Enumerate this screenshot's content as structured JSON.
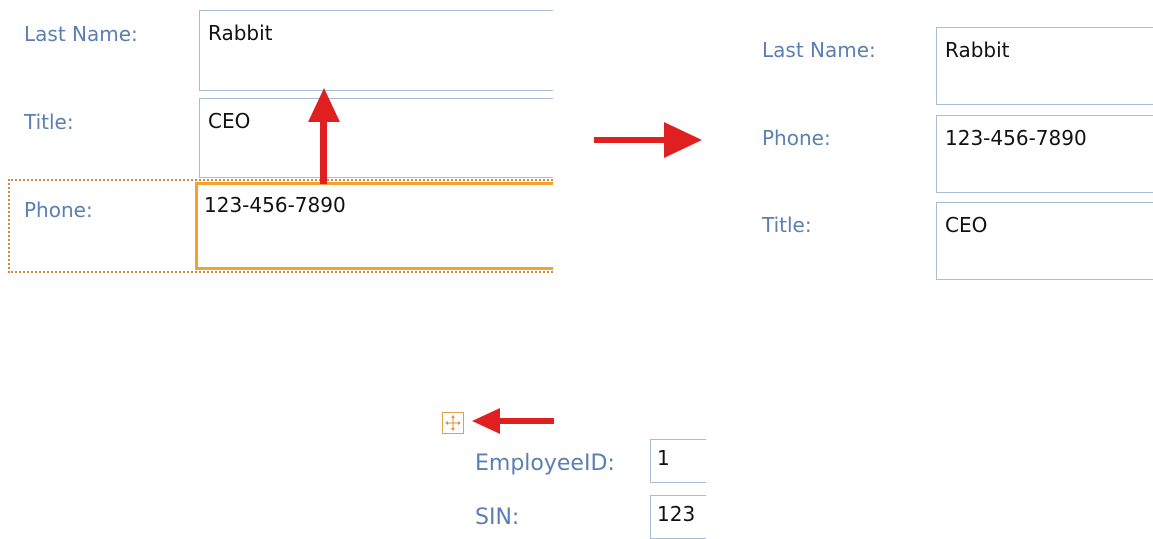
{
  "before": {
    "last_name_label": "Last Name:",
    "last_name_value": "Rabbit",
    "title_label": "Title:",
    "title_value": "CEO",
    "phone_label": "Phone:",
    "phone_value": "123-456-7890"
  },
  "after": {
    "last_name_label": "Last Name:",
    "last_name_value": "Rabbit",
    "phone_label": "Phone:",
    "phone_value": "123-456-7890",
    "title_label": "Title:",
    "title_value": "CEO"
  },
  "layout_handle": {
    "employee_id_label": "EmployeeID:",
    "employee_id_value": "1",
    "sin_label": "SIN:",
    "sin_value": "123"
  },
  "colors": {
    "label": "#5b7fb3",
    "selection": "#f5a030",
    "arrow": "#e02020",
    "border": "#a8bcd6"
  },
  "icons": [
    "move-handle-icon",
    "arrow-up-icon",
    "arrow-right-icon",
    "arrow-left-icon"
  ]
}
